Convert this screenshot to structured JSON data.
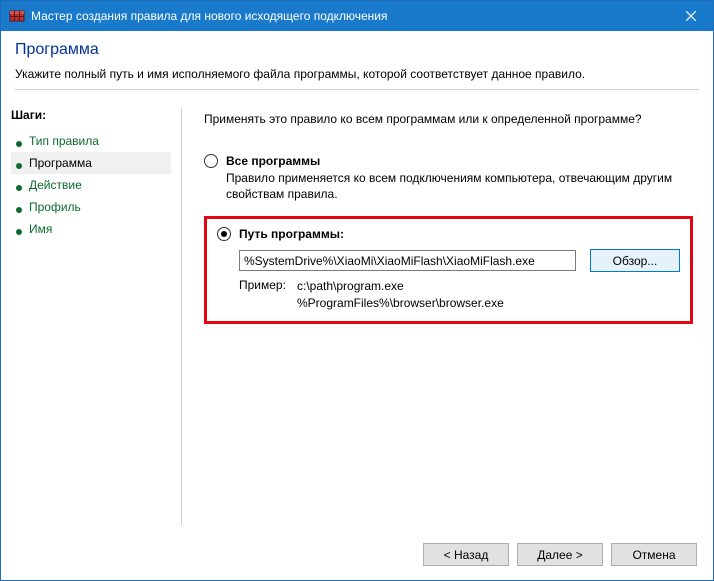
{
  "titlebar": {
    "title": "Мастер создания правила для нового исходящего подключения"
  },
  "header": {
    "title": "Программа",
    "subtitle": "Укажите полный путь и имя исполняемого файла программы, которой соответствует данное правило."
  },
  "sidebar": {
    "heading": "Шаги:",
    "items": [
      {
        "label": "Тип правила"
      },
      {
        "label": "Программа"
      },
      {
        "label": "Действие"
      },
      {
        "label": "Профиль"
      },
      {
        "label": "Имя"
      }
    ]
  },
  "main": {
    "question": "Применять это правило ко всем программам или к определенной программе?",
    "option_all": {
      "label": "Все программы",
      "desc": "Правило применяется ко всем подключениям компьютера, отвечающим другим свойствам правила."
    },
    "option_path": {
      "label": "Путь программы:",
      "value": "%SystemDrive%\\XiaoMi\\XiaoMiFlash\\XiaoMiFlash.exe",
      "browse": "Обзор...",
      "example_label": "Пример:",
      "example1": "c:\\path\\program.exe",
      "example2": "%ProgramFiles%\\browser\\browser.exe"
    }
  },
  "footer": {
    "back": "< Назад",
    "next": "Далее >",
    "cancel": "Отмена"
  }
}
